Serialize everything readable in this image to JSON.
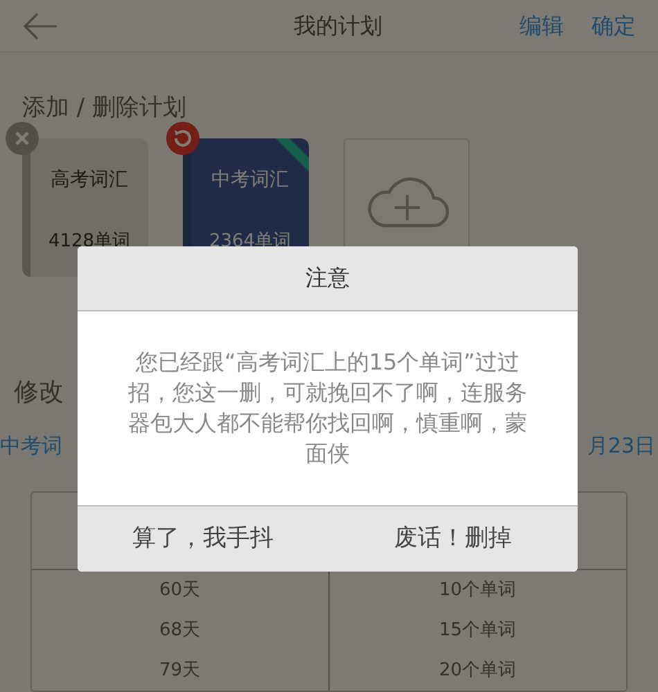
{
  "header": {
    "title": "我的计划",
    "actions": [
      "编辑",
      "确定"
    ]
  },
  "plans_section": {
    "title": "添加 / 删除计划",
    "plans": [
      {
        "name": "高考词汇",
        "count": "4128单词",
        "selected": false
      },
      {
        "name": "中考词汇",
        "count": "2364单词",
        "selected": true
      }
    ]
  },
  "modify_section": {
    "title": "修改",
    "plan": "中考词",
    "date": "月23日"
  },
  "table": {
    "rows": [
      [
        "60天",
        "10个单词"
      ],
      [
        "68天",
        "15个单词"
      ],
      [
        "79天",
        "20个单词"
      ]
    ]
  },
  "dialog": {
    "title": "注意",
    "message": "您已经跟“高考词汇上的15个单词”过过招，您这一删，可就挽回不了啊，连服务器包大人都不能帮你找回啊，慎重啊，蒙面侠",
    "buttons": [
      "算了，我手抖",
      "废话！删掉"
    ]
  }
}
